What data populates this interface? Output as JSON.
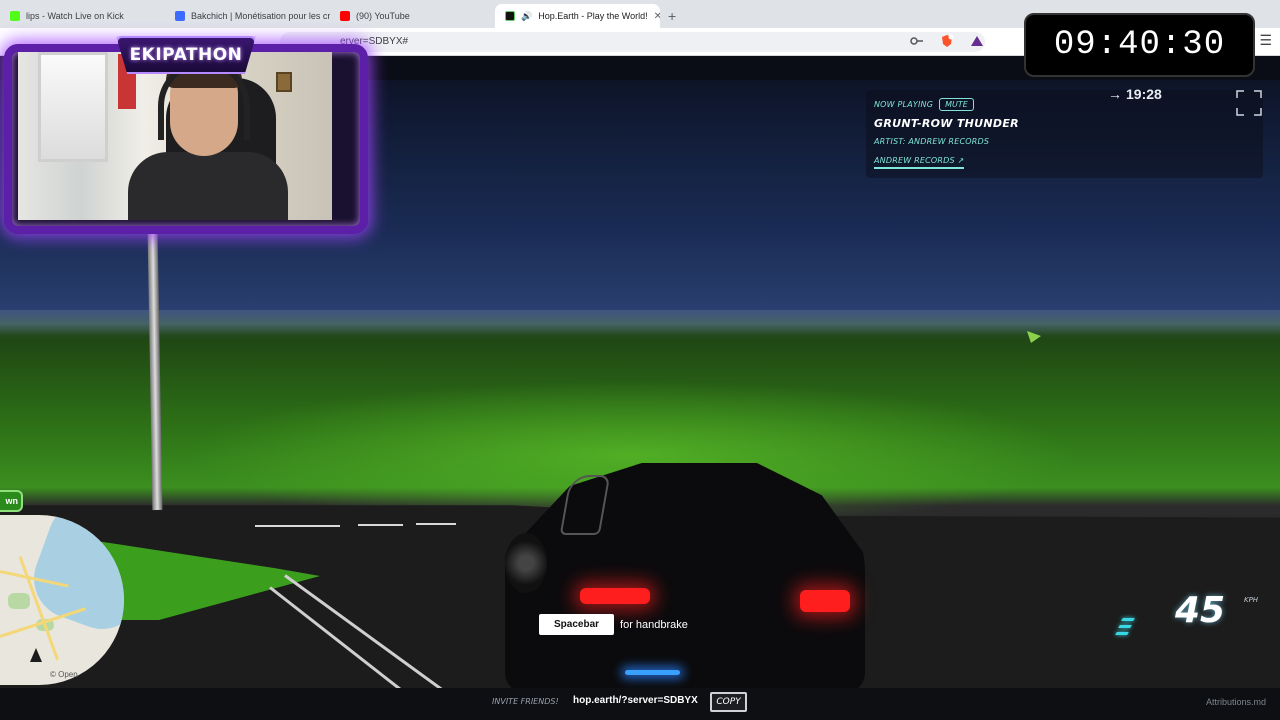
{
  "browser": {
    "tabs": [
      {
        "label": "lips - Watch Live on Kick",
        "icon_color": "#53fc18"
      },
      {
        "label": "Bakchich | Monétisation pour les créa",
        "icon_color": "#3b6cff"
      },
      {
        "label": "(90) YouTube",
        "icon_color": "#ff0000"
      },
      {
        "label": "Hop.Earth - Play the World!",
        "icon_color": "#111111",
        "active": true
      }
    ],
    "new_tab_label": "+",
    "url": "erver=SDBYX#",
    "menu_icon": "kebab-menu-icon"
  },
  "timer": {
    "value": "09:40:30"
  },
  "webcam": {
    "badge_text": "EKIPATHON",
    "frame_color": "#7a2cff"
  },
  "music": {
    "now_playing_label": "NOW PLAYING",
    "mute_label": "MUTE",
    "song_title": "GRUNT-ROW THUNDER",
    "artist": "ARTIST: ANDREW RECORDS",
    "label_link": "ANDREW RECORDS ↗"
  },
  "game_clock": {
    "arrow": "→",
    "time": "19:28"
  },
  "map": {
    "zone_label": "wn",
    "credit": "© Open"
  },
  "hint": {
    "key": "Spacebar",
    "action": "for handbrake"
  },
  "speedometer": {
    "value": "45",
    "unit": "KPH"
  },
  "footer": {
    "invite_label": "INVITE FRIENDS!",
    "server_url": "hop.earth/?server=SDBYX",
    "copy_label": "COPY",
    "attributions": "Attributions.md"
  }
}
